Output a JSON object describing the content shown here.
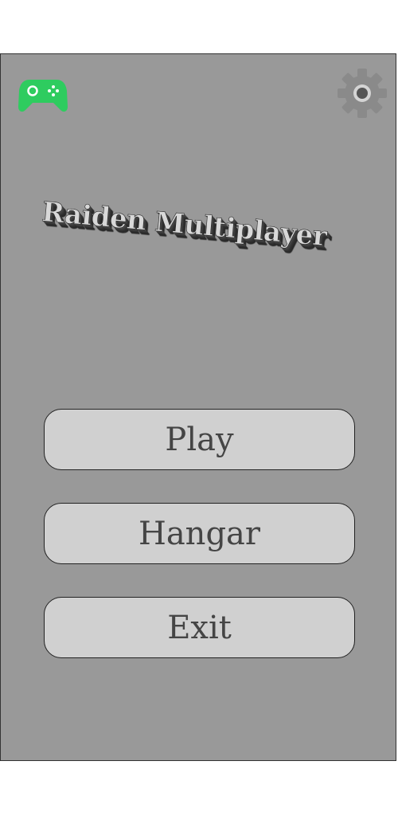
{
  "header": {
    "left_icon": "gamepad-icon",
    "right_icon": "gear-icon",
    "accent_color": "#2ecc5f"
  },
  "title": {
    "text": "Raiden Multiplayer"
  },
  "menu": {
    "play_label": "Play",
    "hangar_label": "Hangar",
    "exit_label": "Exit"
  }
}
